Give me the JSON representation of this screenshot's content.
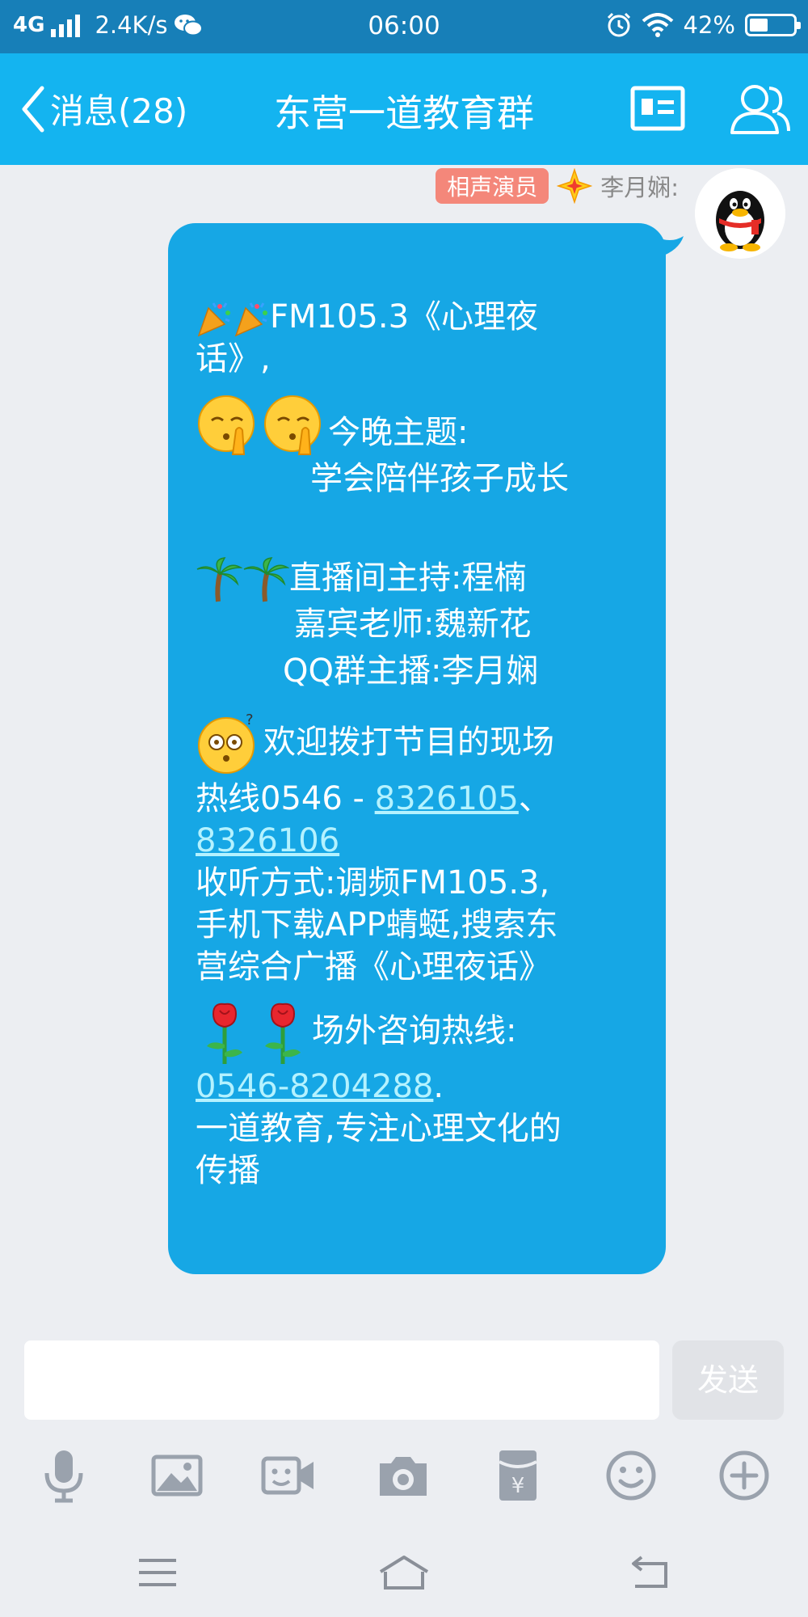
{
  "status_bar": {
    "network": "4G",
    "speed": "2.4K/s",
    "time": "06:00",
    "battery": "42%"
  },
  "nav": {
    "back_label": "消息(28)",
    "title": "东营一道教育群"
  },
  "message": {
    "sender_title": "相声演员",
    "sender_name": "李月娴:",
    "lines": {
      "l1": "FM105.3《心理夜",
      "l2": "话》,",
      "l3": "今晚主题:",
      "l4": "学会陪伴孩子成长",
      "l5": "直播间主持:程楠",
      "l6": "嘉宾老师:魏新花",
      "l7": "QQ群主播:李月娴",
      "l8": "欢迎拨打节目的现场",
      "l9a": "热线0546 - ",
      "l9link": "8326105",
      "l9b": "、",
      "l10link": "8326106",
      "l11": "收听方式:调频FM105.3,",
      "l12": "手机下载APP蜻蜓,搜索东",
      "l13": "营综合广播《心理夜话》",
      "l14": "场外咨询热线:",
      "l15link": "0546-8204288",
      "l15b": ".",
      "l16": "一道教育,专注心理文化的",
      "l17": "传播"
    }
  },
  "composer": {
    "input_value": "",
    "send_label": "发送"
  },
  "icons": {
    "toolbar": [
      "microphone-icon",
      "image-icon",
      "video-icon",
      "camera-icon",
      "red-packet-icon",
      "emoji-icon",
      "plus-icon"
    ],
    "system_nav": [
      "menu-icon",
      "home-icon",
      "back-icon"
    ]
  },
  "colors": {
    "status_bar": "#177fb8",
    "nav_bar": "#14b4f0",
    "bubble": "#16a7e5",
    "link": "#b4f2ff",
    "badge": "#f4877a"
  }
}
